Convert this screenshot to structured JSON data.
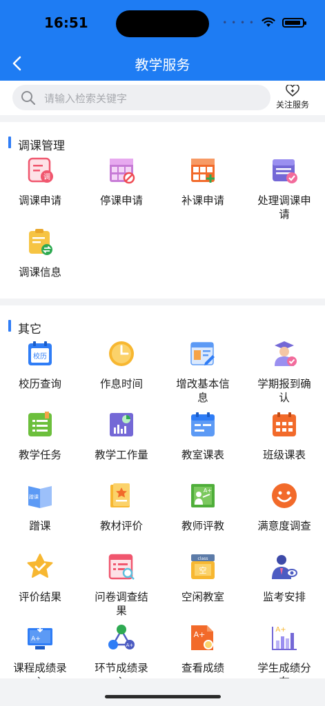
{
  "status_bar": {
    "time": "16:51"
  },
  "nav": {
    "title": "教学服务"
  },
  "search": {
    "placeholder": "请输入检索关键字",
    "follow_label": "关注服务"
  },
  "sections": [
    {
      "title": "调课管理",
      "items": [
        {
          "label": "调课申请",
          "icon": "reschedule-apply-icon"
        },
        {
          "label": "停课申请",
          "icon": "suspend-class-icon"
        },
        {
          "label": "补课申请",
          "icon": "makeup-class-icon"
        },
        {
          "label": "处理调课申请",
          "icon": "process-reschedule-icon"
        },
        {
          "label": "调课信息",
          "icon": "reschedule-info-icon"
        }
      ]
    },
    {
      "title": "其它",
      "items": [
        {
          "label": "校历查询",
          "icon": "school-calendar-icon"
        },
        {
          "label": "作息时间",
          "icon": "clock-icon"
        },
        {
          "label": "增改基本信息",
          "icon": "edit-info-icon"
        },
        {
          "label": "学期报到确认",
          "icon": "graduate-check-icon"
        },
        {
          "label": "教学任务",
          "icon": "teaching-task-icon"
        },
        {
          "label": "教学工作量",
          "icon": "workload-chart-icon"
        },
        {
          "label": "教室课表",
          "icon": "classroom-schedule-icon"
        },
        {
          "label": "班级课表",
          "icon": "class-schedule-icon"
        },
        {
          "label": "蹭课",
          "icon": "audit-book-icon"
        },
        {
          "label": "教材评价",
          "icon": "textbook-eval-icon"
        },
        {
          "label": "教师评教",
          "icon": "teacher-eval-icon"
        },
        {
          "label": "满意度调查",
          "icon": "smiley-icon"
        },
        {
          "label": "评价结果",
          "icon": "star-icon"
        },
        {
          "label": "问卷调查结果",
          "icon": "survey-icon"
        },
        {
          "label": "空闲教室",
          "icon": "empty-room-icon"
        },
        {
          "label": "监考安排",
          "icon": "invigilator-icon"
        },
        {
          "label": "课程成绩录入",
          "icon": "grade-entry-icon"
        },
        {
          "label": "环节成绩录入",
          "icon": "link-grade-icon"
        },
        {
          "label": "查看成绩",
          "icon": "view-grade-icon"
        },
        {
          "label": "学生成绩分布",
          "icon": "grade-dist-icon"
        }
      ]
    }
  ],
  "icon_badges": {
    "reschedule": "调",
    "calendar": "校历",
    "audit": "蹭课",
    "empty_room": "空",
    "grade_a_plus": "A+",
    "class_tag": "class"
  },
  "colors": {
    "header": "#1e7cf3",
    "accent": "#2f7df6"
  }
}
